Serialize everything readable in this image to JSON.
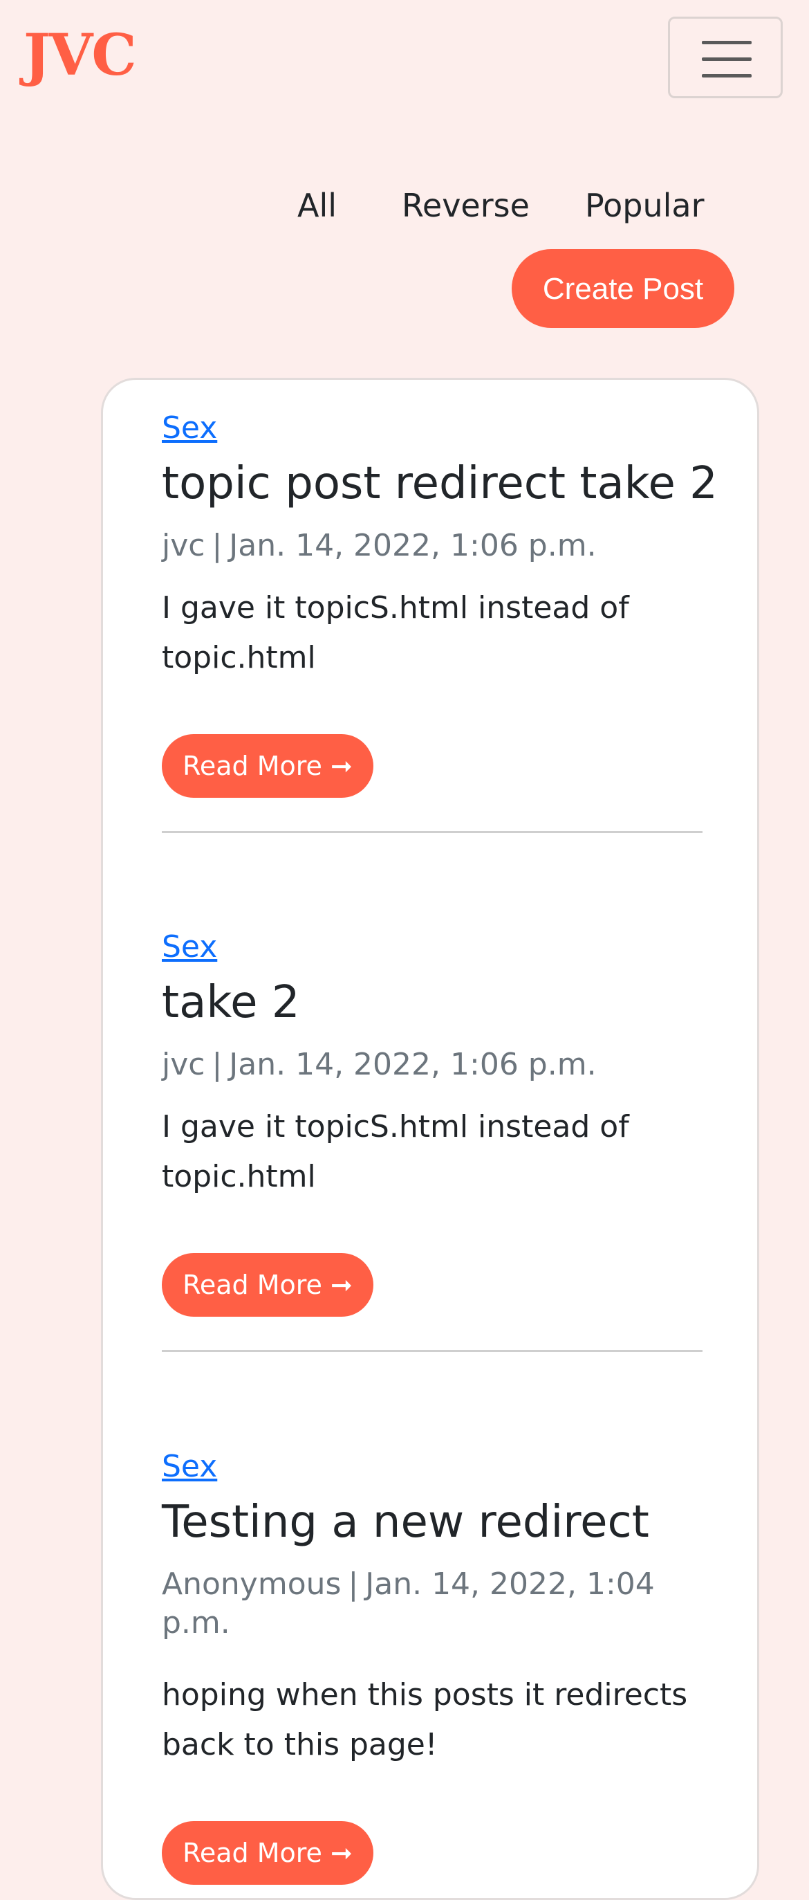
{
  "navbar": {
    "brand": "JVC",
    "toggler_icon": "hamburger-menu-icon"
  },
  "sort_nav": {
    "all": "All",
    "reverse": "Reverse",
    "popular": "Popular"
  },
  "create_post_label": "Create Post",
  "posts": [
    {
      "topic": "Sex",
      "title": "topic post redirect take 2",
      "author": "jvc",
      "separator": "|",
      "date": "Jan. 14, 2022, 1:06 p.m.",
      "body": "I gave it topicS.html instead of topic.html",
      "read_more": "Read More ➞"
    },
    {
      "topic": "Sex",
      "title": "take 2",
      "author": "jvc",
      "separator": "|",
      "date": "Jan. 14, 2022, 1:06 p.m.",
      "body": "I gave it topicS.html instead of topic.html",
      "read_more": "Read More ➞"
    },
    {
      "topic": "Sex",
      "title": "Testing a new redirect",
      "author": "Anonymous",
      "separator": "|",
      "date": "Jan. 14, 2022, 1:04 p.m.",
      "body": "hoping when this posts it redirects back to this page!",
      "read_more": "Read More ➞"
    }
  ],
  "colors": {
    "accent": "#ff5f45",
    "background": "#fdeeec",
    "link": "#0d6efd",
    "muted": "#6c757d"
  }
}
